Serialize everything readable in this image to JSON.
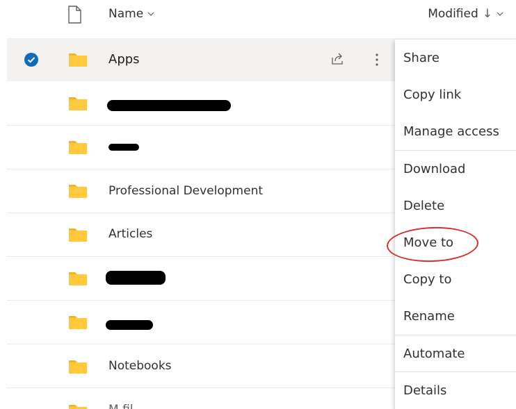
{
  "header": {
    "name_label": "Name",
    "modified_label": "Modified",
    "sort_arrow": "↓"
  },
  "rows": [
    {
      "name": "Apps",
      "selected": true,
      "redacted": false
    },
    {
      "name": "",
      "selected": false,
      "redacted": true
    },
    {
      "name": "",
      "selected": false,
      "redacted": true
    },
    {
      "name": "Professional Development",
      "selected": false,
      "redacted": false
    },
    {
      "name": "Articles",
      "selected": false,
      "redacted": false
    },
    {
      "name": "",
      "selected": false,
      "redacted": true
    },
    {
      "name": "",
      "selected": false,
      "redacted": true
    },
    {
      "name": "Notebooks",
      "selected": false,
      "redacted": false
    },
    {
      "name": "M fil",
      "selected": false,
      "redacted": false
    }
  ],
  "context_menu": {
    "items": [
      {
        "label": "Share"
      },
      {
        "label": "Copy link"
      },
      {
        "label": "Manage access"
      },
      {
        "label": "Download"
      },
      {
        "label": "Delete"
      },
      {
        "label": "Move to",
        "highlighted_annotation": true
      },
      {
        "label": "Copy to"
      },
      {
        "label": "Rename"
      },
      {
        "label": "Automate"
      },
      {
        "label": "Details"
      }
    ]
  },
  "colors": {
    "accent": "#0f6cbd",
    "folder": "#ffc83d",
    "folder_tab": "#f0b429",
    "annotation": "#d6322a",
    "redaction": "#000000"
  },
  "icons": [
    "file-type-icon",
    "chevron-down-icon",
    "checkmark-icon",
    "folder-icon",
    "share-icon",
    "more-options-icon"
  ]
}
